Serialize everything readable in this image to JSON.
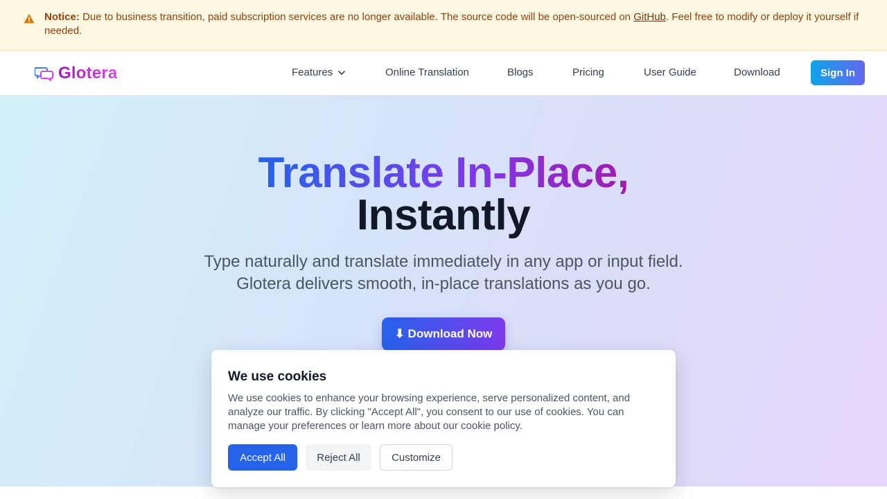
{
  "notice": {
    "label": "Notice:",
    "text_before": " Due to business transition, paid subscription services are no longer available. The source code will be open-sourced on ",
    "link": "GitHub",
    "text_after": ". Feel free to modify or deploy it yourself if needed.",
    "icon": "warning-icon"
  },
  "navbar": {
    "logo_text": "Glotera",
    "items": {
      "features": "Features",
      "online_translation": "Online Translation",
      "blogs": "Blogs",
      "pricing": "Pricing",
      "user_guide": "User Guide",
      "download": "Download"
    },
    "sign_in": "Sign In"
  },
  "hero": {
    "title_line1": "Translate In-Place,",
    "title_line2": "Instantly",
    "subtitle_line1": "Type naturally and translate immediately in any app or input field.",
    "subtitle_line2": "Glotera delivers smooth, in-place translations as you go.",
    "cta": "⬇ Download Now"
  },
  "cookie": {
    "title": "We use cookies",
    "text": "We use cookies to enhance your browsing experience, serve personalized content, and analyze our traffic. By clicking \"Accept All\", you consent to our use of cookies. You can manage your preferences or learn more about our cookie policy.",
    "accept": "Accept All",
    "reject": "Reject All",
    "customize": "Customize"
  },
  "colors": {
    "notice_bg": "#fdf8e1",
    "notice_text": "#92400e",
    "brand": "#c026d3",
    "accent_blue": "#2563eb",
    "accent_purple": "#7c3aed"
  }
}
